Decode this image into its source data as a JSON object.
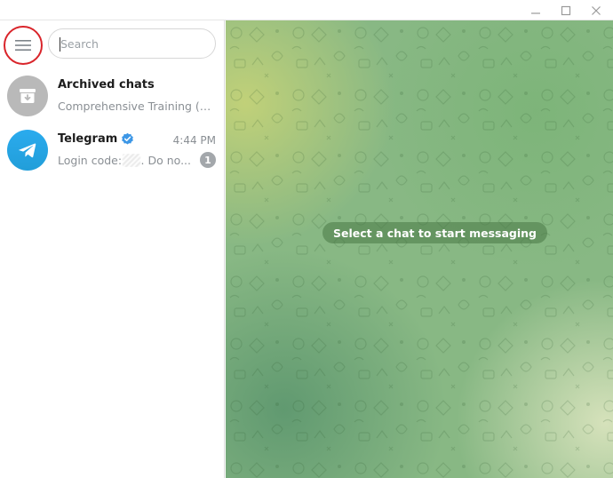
{
  "search": {
    "placeholder": "Search"
  },
  "chats": [
    {
      "title": "Archived chats",
      "subtitle": "Comprehensive Training (Ge..."
    },
    {
      "title": "Telegram",
      "time": "4:44 PM",
      "preview_prefix": "Login code:",
      "preview_suffix": ". Do no...",
      "unread": "1"
    }
  ],
  "main": {
    "empty_message": "Select a chat to start messaging"
  },
  "colors": {
    "accent_red_highlight": "#d9242a",
    "telegram_blue": "#2aabee",
    "verified_blue": "#3d97e6",
    "archive_gray": "#b9b9b9"
  }
}
